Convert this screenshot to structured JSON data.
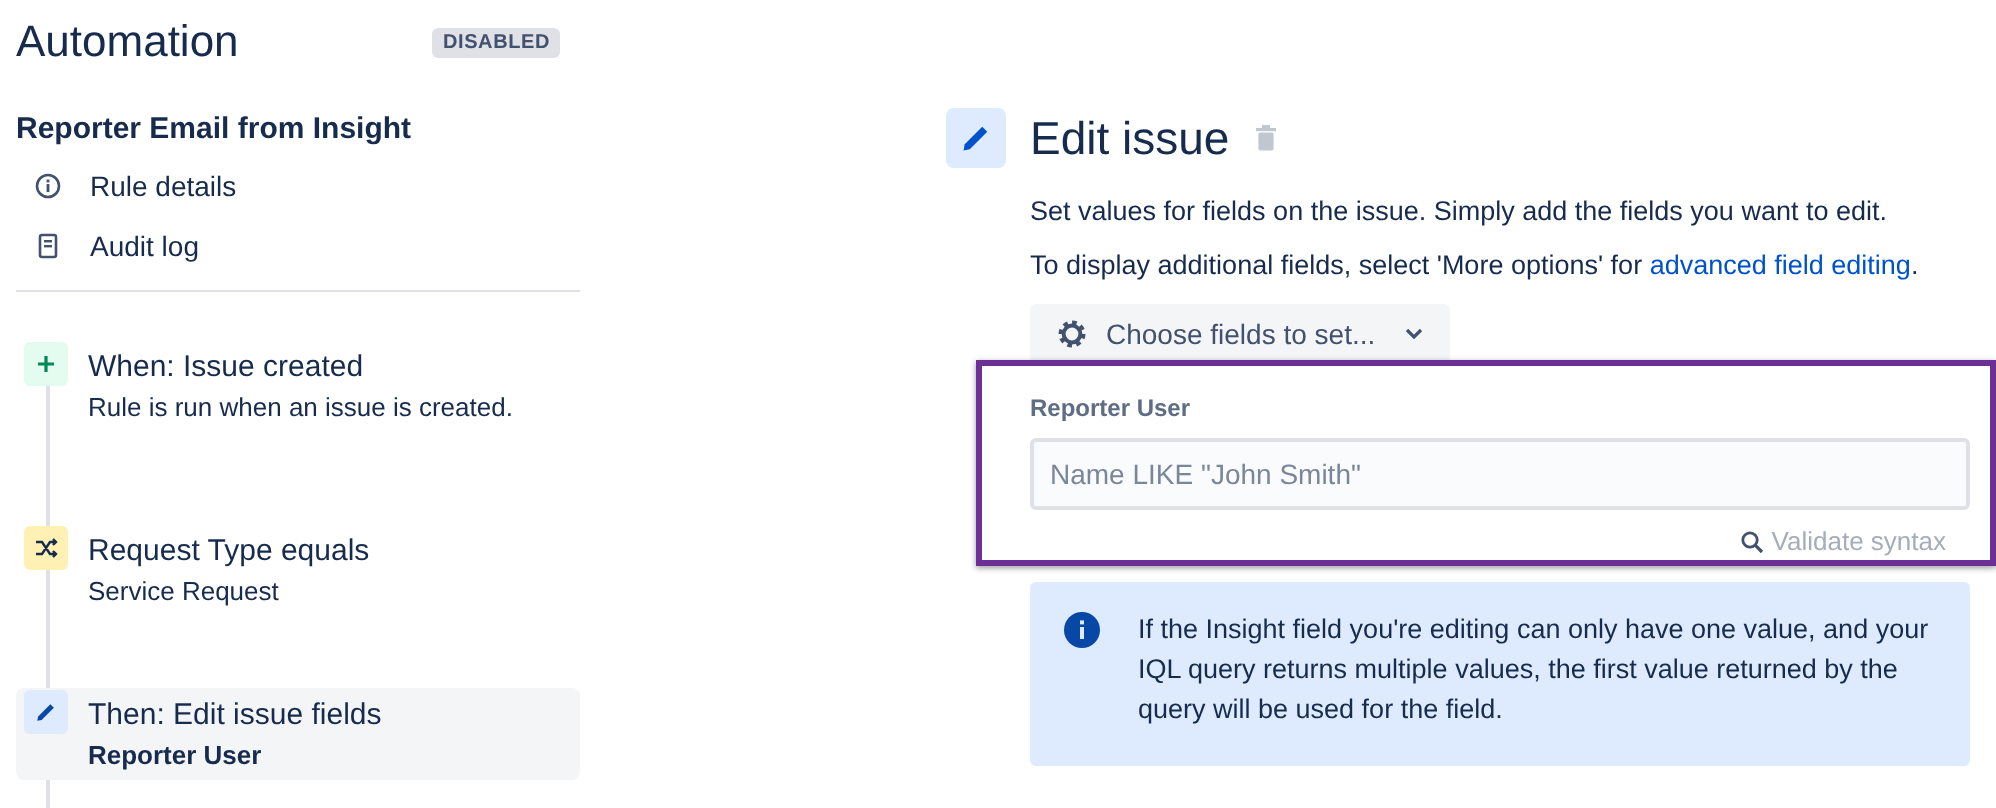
{
  "app": {
    "title": "Automation",
    "status": "DISABLED"
  },
  "rule": {
    "name": "Reporter Email from Insight",
    "links": [
      {
        "label": "Rule details",
        "kind": "info"
      },
      {
        "label": "Audit log",
        "kind": "log"
      }
    ]
  },
  "steps": [
    {
      "kind": "trigger",
      "title": "When: Issue created",
      "subtitle": "Rule is run when an issue is created.",
      "selected": false
    },
    {
      "kind": "condition",
      "title": "Request Type equals",
      "subtitle": "Service Request",
      "selected": false
    },
    {
      "kind": "action",
      "title": "Then: Edit issue fields",
      "subtitle": "Reporter User",
      "selected": true
    }
  ],
  "editor": {
    "title": "Edit issue",
    "description": "Set values for fields on the issue. Simply add the fields you want to edit.",
    "more_text": "To display additional fields, select 'More options' for ",
    "more_link": "advanced field editing",
    "more_end": ".",
    "choose_button": "Choose fields to set...",
    "field": {
      "label": "Reporter User",
      "placeholder": "Name LIKE \"John Smith\"",
      "validate": "Validate syntax"
    },
    "info": "If the Insight field you're editing can only have one value, and your IQL query returns multiple values, the first value returned by the query will be used for the field."
  }
}
